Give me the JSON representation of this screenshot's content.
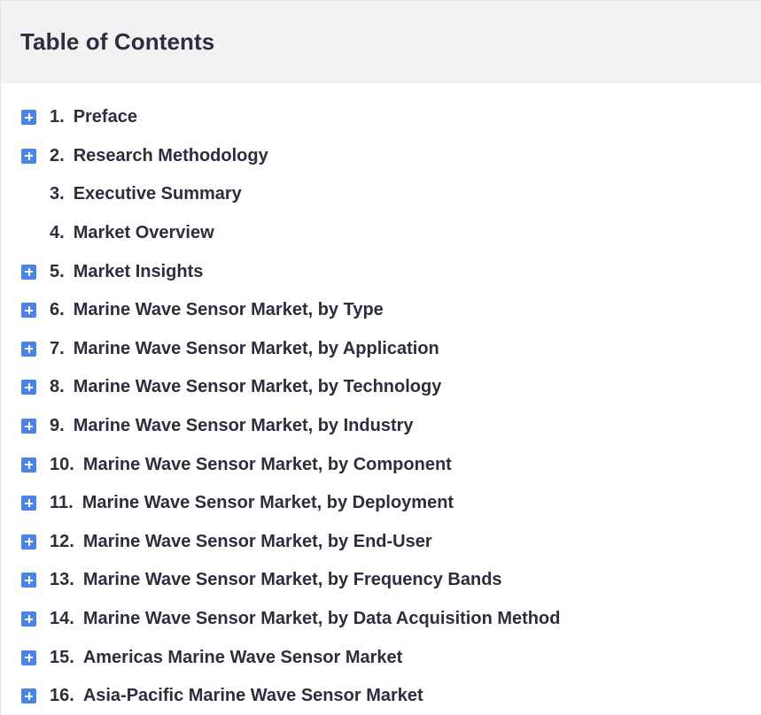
{
  "header": {
    "title": "Table of Contents"
  },
  "toc": {
    "items": [
      {
        "number": "1.",
        "label": "Preface",
        "expandable": true
      },
      {
        "number": "2.",
        "label": "Research Methodology",
        "expandable": true
      },
      {
        "number": "3.",
        "label": "Executive Summary",
        "expandable": false
      },
      {
        "number": "4.",
        "label": "Market Overview",
        "expandable": false
      },
      {
        "number": "5.",
        "label": "Market Insights",
        "expandable": true
      },
      {
        "number": "6.",
        "label": "Marine Wave Sensor Market, by Type",
        "expandable": true
      },
      {
        "number": "7.",
        "label": "Marine Wave Sensor Market, by Application",
        "expandable": true
      },
      {
        "number": "8.",
        "label": "Marine Wave Sensor Market, by Technology",
        "expandable": true
      },
      {
        "number": "9.",
        "label": "Marine Wave Sensor Market, by Industry",
        "expandable": true
      },
      {
        "number": "10.",
        "label": "Marine Wave Sensor Market, by Component",
        "expandable": true
      },
      {
        "number": "11.",
        "label": "Marine Wave Sensor Market, by Deployment",
        "expandable": true
      },
      {
        "number": "12.",
        "label": "Marine Wave Sensor Market, by End-User",
        "expandable": true
      },
      {
        "number": "13.",
        "label": "Marine Wave Sensor Market, by Frequency Bands",
        "expandable": true
      },
      {
        "number": "14.",
        "label": "Marine Wave Sensor Market, by Data Acquisition Method",
        "expandable": true
      },
      {
        "number": "15.",
        "label": "Americas Marine Wave Sensor Market",
        "expandable": true
      },
      {
        "number": "16.",
        "label": "Asia-Pacific Marine Wave Sensor Market",
        "expandable": true
      }
    ]
  },
  "colors": {
    "expander": "#4a84e4",
    "header_bg": "#f2f2f2",
    "text": "#2d2d3c"
  },
  "icons": {
    "expander": "plus-square-icon"
  }
}
